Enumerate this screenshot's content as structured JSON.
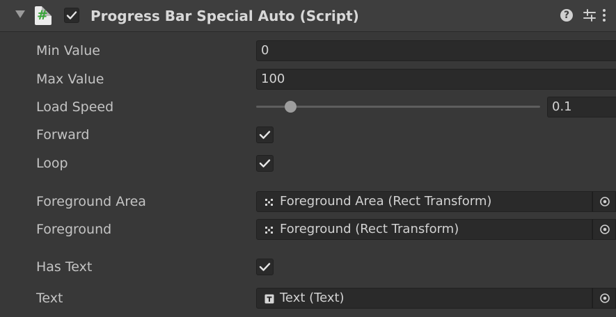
{
  "header": {
    "title": "Progress Bar Special Auto (Script)",
    "enabled": true,
    "icons": {
      "foldout": "triangle-down-icon",
      "script": "csharp-script-icon",
      "help": "help-icon",
      "preset": "preset-icon",
      "menu": "kebab-menu-icon"
    }
  },
  "fields": {
    "min_value": {
      "label": "Min Value",
      "value": "0"
    },
    "max_value": {
      "label": "Max Value",
      "value": "100"
    },
    "load_speed": {
      "label": "Load Speed",
      "value": "0.1",
      "fraction": 0.12
    },
    "forward": {
      "label": "Forward",
      "checked": true
    },
    "loop": {
      "label": "Loop",
      "checked": true
    },
    "foreground_area": {
      "label": "Foreground Area",
      "value": "Foreground Area (Rect Transform)",
      "icon": "rect-transform-icon"
    },
    "foreground": {
      "label": "Foreground",
      "value": "Foreground (Rect Transform)",
      "icon": "rect-transform-icon"
    },
    "has_text": {
      "label": "Has Text",
      "checked": true
    },
    "text": {
      "label": "Text",
      "value": "Text (Text)",
      "icon": "text-component-icon"
    }
  },
  "colors": {
    "background": "#383838",
    "header": "#3e3e3e",
    "field": "#2a2a2a",
    "script_hash": "#3aa63a"
  }
}
